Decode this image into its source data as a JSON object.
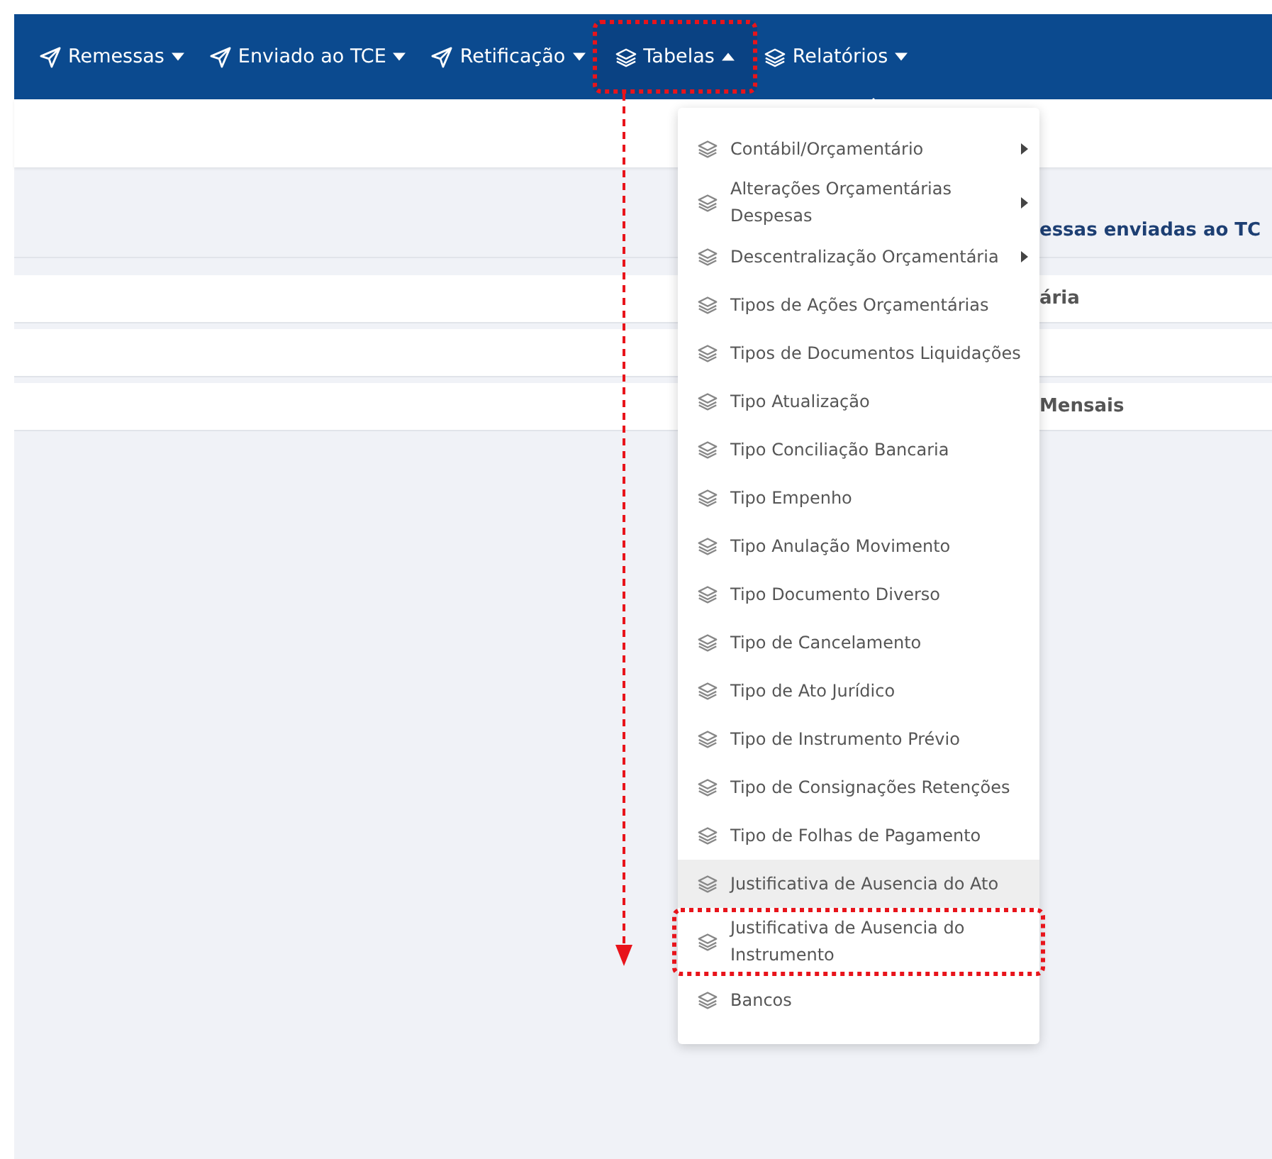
{
  "nav": [
    {
      "label": "Remessas",
      "kind": "send",
      "open": false,
      "marked": false
    },
    {
      "label": "Enviado ao TCE",
      "kind": "send",
      "open": false,
      "marked": false
    },
    {
      "label": "Retificação",
      "kind": "send",
      "open": false,
      "marked": false
    },
    {
      "label": "Tabelas",
      "kind": "layers",
      "open": true,
      "marked": true
    },
    {
      "label": "Relatórios",
      "kind": "layers",
      "open": false,
      "marked": false
    }
  ],
  "background": {
    "heading": "essas enviadas ao TC",
    "rows": [
      {
        "kind": "text",
        "text": "ária"
      },
      {
        "kind": "blank"
      },
      {
        "kind": "text",
        "text": "Mensais"
      }
    ]
  },
  "menu": [
    {
      "label": "Contábil/Orçamentário",
      "submenu": true,
      "highlighted": false,
      "marked": false
    },
    {
      "label": "Alterações Orçamentárias Despesas",
      "submenu": true,
      "highlighted": false,
      "marked": false
    },
    {
      "label": "Descentralização Orçamentária",
      "submenu": true,
      "highlighted": false,
      "marked": false
    },
    {
      "label": "Tipos de Ações Orçamentárias",
      "submenu": false,
      "highlighted": false,
      "marked": false
    },
    {
      "label": "Tipos de Documentos Liquidações",
      "submenu": false,
      "highlighted": false,
      "marked": false
    },
    {
      "label": "Tipo Atualização",
      "submenu": false,
      "highlighted": false,
      "marked": false
    },
    {
      "label": "Tipo Conciliação Bancaria",
      "submenu": false,
      "highlighted": false,
      "marked": false
    },
    {
      "label": "Tipo Empenho",
      "submenu": false,
      "highlighted": false,
      "marked": false
    },
    {
      "label": "Tipo Anulação Movimento",
      "submenu": false,
      "highlighted": false,
      "marked": false
    },
    {
      "label": "Tipo Documento Diverso",
      "submenu": false,
      "highlighted": false,
      "marked": false
    },
    {
      "label": "Tipo de Cancelamento",
      "submenu": false,
      "highlighted": false,
      "marked": false
    },
    {
      "label": "Tipo de Ato Jurídico",
      "submenu": false,
      "highlighted": false,
      "marked": false
    },
    {
      "label": "Tipo de Instrumento Prévio",
      "submenu": false,
      "highlighted": false,
      "marked": false
    },
    {
      "label": "Tipo de Consignações Retenções",
      "submenu": false,
      "highlighted": false,
      "marked": false
    },
    {
      "label": "Tipo de Folhas de Pagamento",
      "submenu": false,
      "highlighted": false,
      "marked": false
    },
    {
      "label": "Justificativa de Ausencia do Ato",
      "submenu": false,
      "highlighted": true,
      "marked": false
    },
    {
      "label": "Justificativa de Ausencia do Instrumento",
      "submenu": false,
      "highlighted": false,
      "marked": true
    },
    {
      "label": "Bancos",
      "submenu": false,
      "highlighted": false,
      "marked": false
    }
  ]
}
